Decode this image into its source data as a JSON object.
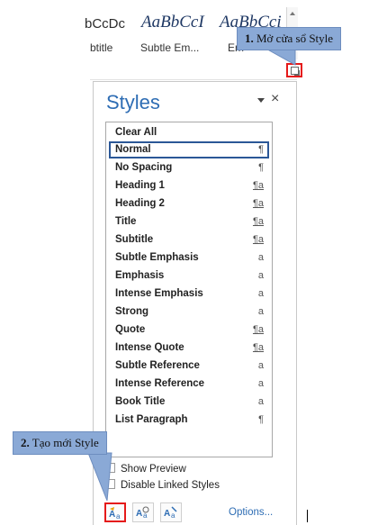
{
  "gallery": {
    "items": [
      {
        "sample": "bCcDc",
        "name": "btitle"
      },
      {
        "sample": "AaBbCcI",
        "name": "Subtle Em..."
      },
      {
        "sample": "AaBbCci",
        "name": "Em"
      }
    ]
  },
  "callouts": {
    "open": {
      "number": "1.",
      "text": "Mở cửa sổ Style"
    },
    "create": {
      "number": "2.",
      "text": "Tạo mới Style"
    },
    "color": "#8aa9d6"
  },
  "pane": {
    "title": "Styles",
    "close_glyph": "×",
    "styles": [
      {
        "label": "Clear All",
        "glyph": "",
        "selected": false
      },
      {
        "label": "Normal",
        "glyph": "¶",
        "selected": true
      },
      {
        "label": "No Spacing",
        "glyph": "¶",
        "selected": false
      },
      {
        "label": "Heading 1",
        "glyph": "¶a",
        "selected": false
      },
      {
        "label": "Heading 2",
        "glyph": "¶a",
        "selected": false
      },
      {
        "label": "Title",
        "glyph": "¶a",
        "selected": false
      },
      {
        "label": "Subtitle",
        "glyph": "¶a",
        "selected": false
      },
      {
        "label": "Subtle Emphasis",
        "glyph": "a",
        "selected": false
      },
      {
        "label": "Emphasis",
        "glyph": "a",
        "selected": false
      },
      {
        "label": "Intense Emphasis",
        "glyph": "a",
        "selected": false
      },
      {
        "label": "Strong",
        "glyph": "a",
        "selected": false
      },
      {
        "label": "Quote",
        "glyph": "¶a",
        "selected": false
      },
      {
        "label": "Intense Quote",
        "glyph": "¶a",
        "selected": false
      },
      {
        "label": "Subtle Reference",
        "glyph": "a",
        "selected": false
      },
      {
        "label": "Intense Reference",
        "glyph": "a",
        "selected": false
      },
      {
        "label": "Book Title",
        "glyph": "a",
        "selected": false
      },
      {
        "label": "List Paragraph",
        "glyph": "¶",
        "selected": false
      }
    ],
    "show_preview": {
      "label": "Show Preview",
      "checked": false
    },
    "disable_linked": {
      "label": "Disable Linked Styles",
      "checked": false
    },
    "buttons": [
      {
        "icon": "new-style-icon"
      },
      {
        "icon": "style-inspector-icon"
      },
      {
        "icon": "manage-styles-icon"
      }
    ],
    "options_label": "Options..."
  },
  "colors": {
    "accent": "#2e6db4",
    "highlight": "#e51a1a",
    "selection": "#2b5797"
  }
}
